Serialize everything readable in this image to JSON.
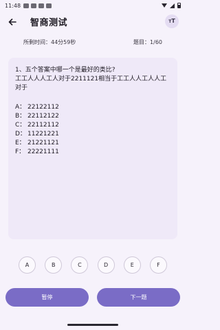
{
  "status_bar": {
    "time": "11:48"
  },
  "app_bar": {
    "title": "智商测试"
  },
  "font_button": {
    "small": "T",
    "big": "T"
  },
  "info": {
    "remaining": "所剩时间：44分59秒",
    "progress": "题目：1/60"
  },
  "question": {
    "text": "1、五个答案中哪一个是最好的类比?\n工工人人人工人对于2211121相当于工工人人工人人工对于",
    "options": [
      {
        "letter": "A：",
        "value": "22122112"
      },
      {
        "letter": "B：",
        "value": "22112122"
      },
      {
        "letter": "C：",
        "value": "22112112"
      },
      {
        "letter": "D：",
        "value": "11221221"
      },
      {
        "letter": "E：",
        "value": "21221121"
      },
      {
        "letter": "F：",
        "value": "22221111"
      }
    ]
  },
  "answers": [
    "A",
    "B",
    "C",
    "D",
    "E",
    "F"
  ],
  "buttons": {
    "pause": "暂停",
    "next": "下一题"
  }
}
